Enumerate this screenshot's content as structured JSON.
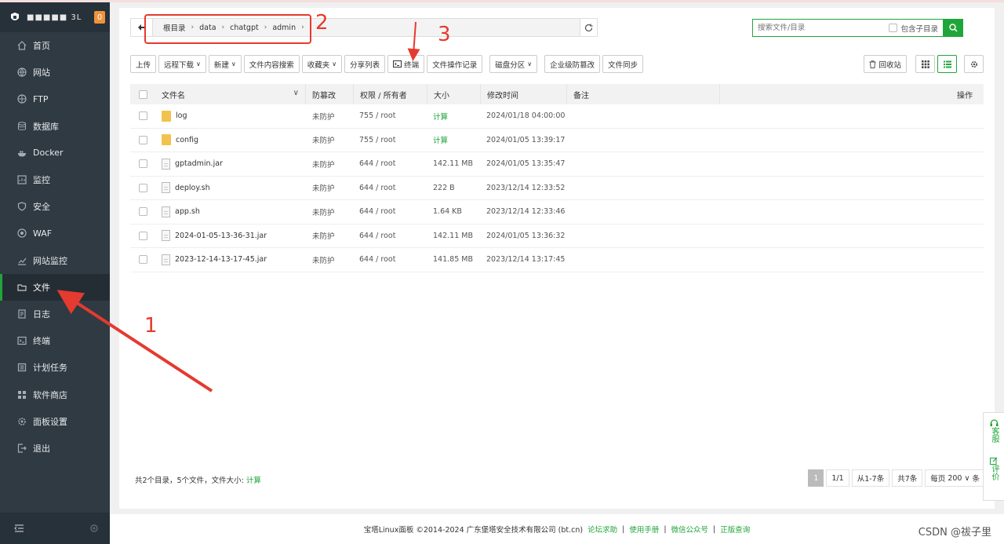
{
  "sidebar": {
    "user": "■■■■■ 3L",
    "badge": "0",
    "items": [
      {
        "label": "首页",
        "icon": "home-icon"
      },
      {
        "label": "网站",
        "icon": "globe-icon"
      },
      {
        "label": "FTP",
        "icon": "ftp-icon"
      },
      {
        "label": "数据库",
        "icon": "database-icon"
      },
      {
        "label": "Docker",
        "icon": "docker-icon"
      },
      {
        "label": "监控",
        "icon": "monitor-icon"
      },
      {
        "label": "安全",
        "icon": "shield-icon"
      },
      {
        "label": "WAF",
        "icon": "waf-icon"
      },
      {
        "label": "网站监控",
        "icon": "chart-icon"
      },
      {
        "label": "文件",
        "icon": "folder-icon",
        "active": true
      },
      {
        "label": "日志",
        "icon": "log-icon"
      },
      {
        "label": "终端",
        "icon": "terminal-icon"
      },
      {
        "label": "计划任务",
        "icon": "task-icon"
      },
      {
        "label": "软件商店",
        "icon": "store-icon"
      },
      {
        "label": "面板设置",
        "icon": "gear-icon"
      },
      {
        "label": "退出",
        "icon": "logout-icon"
      }
    ]
  },
  "path": {
    "crumbs": [
      "根目录",
      "data",
      "chatgpt",
      "admin"
    ]
  },
  "search": {
    "placeholder": "搜索文件/目录",
    "include_sub": "包含子目录"
  },
  "toolbar": {
    "upload": "上传",
    "remote_download": "远程下载",
    "new": "新建",
    "content_search": "文件内容搜索",
    "favorites": "收藏夹",
    "share_list": "分享列表",
    "terminal": "终端",
    "op_log": "文件操作记录",
    "disk": "磁盘分区",
    "tamper": "企业级防篡改",
    "sync": "文件同步",
    "recycle": "回收站"
  },
  "table": {
    "headers": {
      "name": "文件名",
      "protect": "防篡改",
      "perm": "权限 / 所有者",
      "size": "大小",
      "modified": "修改时间",
      "note": "备注",
      "ops": "操作"
    },
    "rows": [
      {
        "name": "log",
        "type": "folder",
        "protect": "未防护",
        "perm": "755 / root",
        "size": "计算",
        "modified": "2024/01/18 04:00:00"
      },
      {
        "name": "config",
        "type": "folder",
        "protect": "未防护",
        "perm": "755 / root",
        "size": "计算",
        "modified": "2024/01/05 13:39:17"
      },
      {
        "name": "gptadmin.jar",
        "type": "file",
        "protect": "未防护",
        "perm": "644 / root",
        "size": "142.11 MB",
        "modified": "2024/01/05 13:35:47"
      },
      {
        "name": "deploy.sh",
        "type": "file",
        "protect": "未防护",
        "perm": "644 / root",
        "size": "222 B",
        "modified": "2023/12/14 12:33:52"
      },
      {
        "name": "app.sh",
        "type": "file",
        "protect": "未防护",
        "perm": "644 / root",
        "size": "1.64 KB",
        "modified": "2023/12/14 12:33:46"
      },
      {
        "name": "2024-01-05-13-36-31.jar",
        "type": "file",
        "protect": "未防护",
        "perm": "644 / root",
        "size": "142.11 MB",
        "modified": "2024/01/05 13:36:32"
      },
      {
        "name": "2023-12-14-13-17-45.jar",
        "type": "file",
        "protect": "未防护",
        "perm": "644 / root",
        "size": "141.85 MB",
        "modified": "2023/12/14 13:17:45"
      }
    ]
  },
  "summary": {
    "text": "共2个目录，5个文件，文件大小:",
    "calc": "计算"
  },
  "pager": {
    "current": "1",
    "pages": "1/1",
    "range": "从1-7条",
    "total": "共7条",
    "per_page_label": "每页",
    "per_page": "200",
    "unit": "条"
  },
  "footer": {
    "copyright": "宝塔Linux面板 ©2014-2024 广东堡塔安全技术有限公司 (bt.cn)",
    "links": [
      "论坛求助",
      "使用手册",
      "微信公众号",
      "正版查询"
    ],
    "sep": "|"
  },
  "float": {
    "service": "客服",
    "rate": "评价"
  },
  "watermark": "CSDN @祓子里",
  "annotations": [
    "1",
    "2",
    "3"
  ],
  "colors": {
    "accent": "#20a53a",
    "sidebar": "#2f3a43",
    "annotation": "#e53a2f"
  }
}
